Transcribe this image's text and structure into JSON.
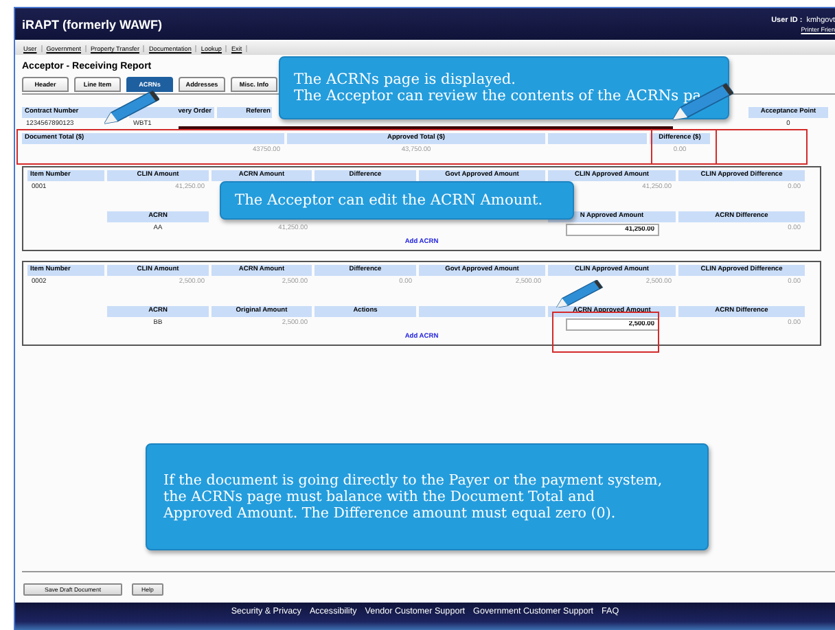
{
  "app": {
    "title": "iRAPT (formerly WAWF)",
    "user_label": "User ID :",
    "user_id": "kmhgovt",
    "printer_link": "Printer Frien"
  },
  "menu": [
    "User",
    "Government",
    "Property Transfer",
    "Documentation",
    "Lookup",
    "Exit"
  ],
  "heading": "Acceptor - Receiving Report",
  "tabs": [
    {
      "label": "Header",
      "selected": false
    },
    {
      "label": "Line Item",
      "selected": false
    },
    {
      "label": "ACRNs",
      "selected": true
    },
    {
      "label": "Addresses",
      "selected": false
    },
    {
      "label": "Misc. Info",
      "selected": false
    }
  ],
  "document": {
    "columns": {
      "contract_number": "Contract Number",
      "delivery_order": "very Order",
      "reference": "Referen",
      "acceptance_point": "Acceptance Point"
    },
    "values": {
      "contract_number": "1234567890123",
      "delivery_order": "WBT1",
      "acceptance_point": "0"
    }
  },
  "totals": {
    "columns": {
      "document_total": "Document Total ($)",
      "approved_total": "Approved Total ($)",
      "difference": "Difference ($)"
    },
    "values": {
      "document_total": "43750.00",
      "approved_total": "43,750.00",
      "difference": "0.00"
    }
  },
  "items": [
    {
      "columns": {
        "item_number": "Item Number",
        "clin_amount": "CLIN Amount",
        "acrn_amount": "ACRN Amount",
        "difference": "Difference",
        "govt_approved_amount": "Govt Approved Amount",
        "clin_approved_amount": "CLIN Approved Amount",
        "clin_approved_difference": "CLIN Approved Difference"
      },
      "values": {
        "item_number": "0001",
        "clin_amount": "41,250.00",
        "clin_approved_amount": "41,250.00",
        "clin_approved_difference": "0.00"
      },
      "acrn_columns": {
        "acrn": "ACRN",
        "approved_amount": "N Approved Amount",
        "difference": "ACRN Difference"
      },
      "acrns": [
        {
          "acrn": "AA",
          "original_amount": "41,250.00",
          "approved_amount": "41,250.00",
          "difference": "0.00"
        }
      ],
      "add_link": "Add ACRN"
    },
    {
      "columns": {
        "item_number": "Item Number",
        "clin_amount": "CLIN Amount",
        "acrn_amount": "ACRN Amount",
        "difference": "Difference",
        "govt_approved_amount": "Govt Approved Amount",
        "clin_approved_amount": "CLIN Approved Amount",
        "clin_approved_difference": "CLIN Approved Difference"
      },
      "values": {
        "item_number": "0002",
        "clin_amount": "2,500.00",
        "acrn_amount": "2,500.00",
        "difference": "0.00",
        "govt_approved_amount": "2,500.00",
        "clin_approved_amount": "2,500.00",
        "clin_approved_difference": "0.00"
      },
      "acrn_columns": {
        "acrn": "ACRN",
        "original_amount": "Original Amount",
        "actions": "Actions",
        "approved_amount": "ACRN Approved Amount",
        "difference": "ACRN Difference"
      },
      "acrns": [
        {
          "acrn": "BB",
          "original_amount": "2,500.00",
          "approved_amount": "2,500.00",
          "difference": "0.00"
        }
      ],
      "add_link": "Add ACRN"
    }
  ],
  "callouts": [
    {
      "lines": [
        "The ACRNs page is displayed.",
        "The Acceptor can review the contents of the ACRNs pa"
      ]
    },
    {
      "lines": [
        "The Acceptor can edit the ACRN Amount."
      ]
    },
    {
      "lines": [
        "If the document is going directly to the Payer or the payment system,",
        "the ACRNs page must balance with the Document Total and",
        "Approved Amount.  The Difference amount must equal zero (0)."
      ]
    }
  ],
  "buttons": [
    "Save Draft Document",
    "Help"
  ],
  "footer_links": [
    "Security & Privacy",
    "Accessibility",
    "Vendor Customer Support",
    "Government Customer Support",
    "FAQ"
  ]
}
